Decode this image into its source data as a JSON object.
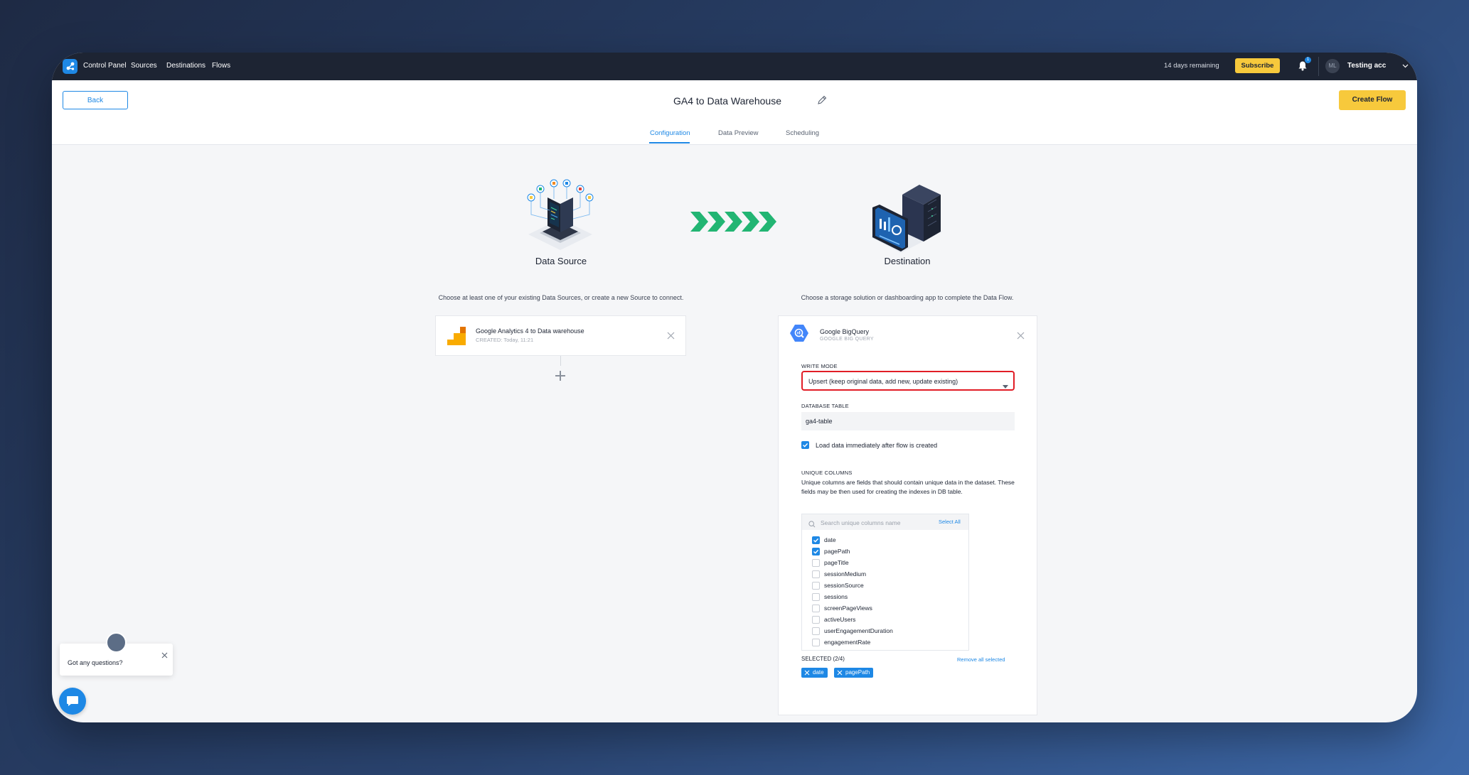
{
  "nav": {
    "links": [
      "Control Panel",
      "Sources",
      "Destinations",
      "Flows"
    ],
    "trial": "14 days remaining",
    "subscribe": "Subscribe",
    "notification_count": "1",
    "avatar_initials": "ML",
    "account": "Testing acc"
  },
  "header": {
    "back": "Back",
    "title": "GA4 to Data Warehouse",
    "create": "Create Flow"
  },
  "tabs": [
    "Configuration",
    "Data Preview",
    "Scheduling"
  ],
  "source": {
    "title": "Data Source",
    "desc": "Choose at least one of your existing Data Sources, or create a new Source to connect.",
    "card_name": "Google Analytics 4 to Data warehouse",
    "card_created": "CREATED: Today, 11:21"
  },
  "destination": {
    "title": "Destination",
    "desc": "Choose a storage solution or dashboarding app to complete the Data Flow.",
    "card_name": "Google BigQuery",
    "card_sub": "GOOGLE BIG QUERY",
    "write_mode_label": "WRITE MODE",
    "write_mode_value": "Upsert (keep original data, add new, update existing)",
    "db_table_label": "DATABASE TABLE",
    "db_table_value": "ga4-table",
    "load_immediately": "Load data immediately after flow is created",
    "unique_label": "UNIQUE COLUMNS",
    "unique_desc": "Unique columns are fields that should contain unique data in the dataset. These fields may be then used for creating the indexes in DB table.",
    "search_placeholder": "Search unique columns name",
    "select_all": "Select All",
    "columns": [
      {
        "name": "date",
        "checked": true
      },
      {
        "name": "pagePath",
        "checked": true
      },
      {
        "name": "pageTitle",
        "checked": false
      },
      {
        "name": "sessionMedium",
        "checked": false
      },
      {
        "name": "sessionSource",
        "checked": false
      },
      {
        "name": "sessions",
        "checked": false
      },
      {
        "name": "screenPageViews",
        "checked": false
      },
      {
        "name": "activeUsers",
        "checked": false
      },
      {
        "name": "userEngagementDuration",
        "checked": false
      },
      {
        "name": "engagementRate",
        "checked": false
      }
    ],
    "selected_label": "SELECTED (2/4)",
    "remove_all": "Remove all selected",
    "chips": [
      "date",
      "pagePath"
    ]
  },
  "chat": {
    "prompt": "Got any questions?"
  },
  "colors": {
    "accent": "#1e88e5",
    "brand_yellow": "#f7c93c",
    "nav_bg": "#1d2433",
    "highlight": "#e11d26",
    "arrow_green": "#22b573"
  }
}
